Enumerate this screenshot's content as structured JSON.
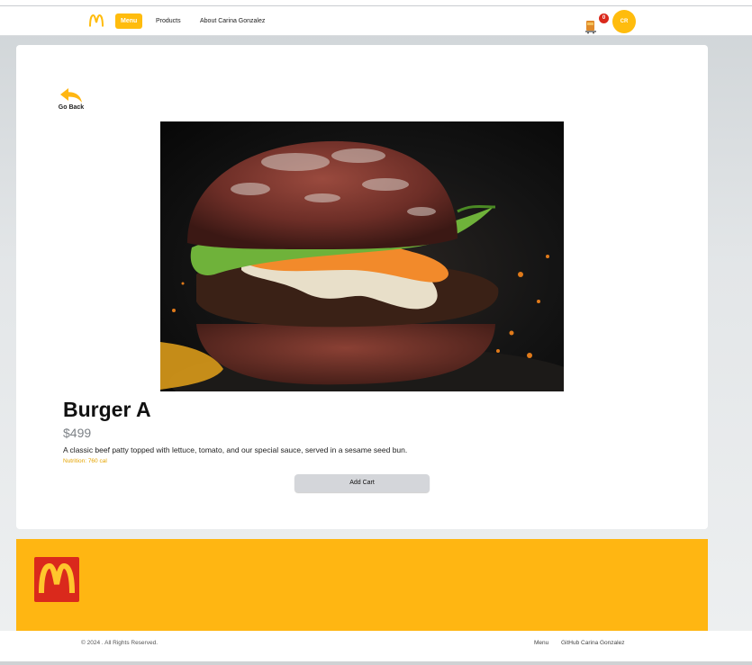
{
  "nav": {
    "links": [
      {
        "label": "Menu",
        "active": true
      },
      {
        "label": "Products",
        "active": false
      },
      {
        "label": "About Carina Gonzalez",
        "active": false
      }
    ],
    "cart_count": "0",
    "avatar_initials": "CR"
  },
  "product": {
    "back_label": "Go Back",
    "title": "Burger A",
    "price": "$499",
    "description": "A classic beef patty topped with lettuce, tomato, and our special sauce, served in a sesame seed bun.",
    "nutrition": "Nutrition: 760 cal",
    "add_button": "Add Cart"
  },
  "footer": {
    "copyright": "© 2024 . All Rights Reserved.",
    "links": [
      "Menu",
      "GitHub Carina Gonzalez"
    ]
  },
  "colors": {
    "brand_yellow": "#ffbc0d",
    "brand_red": "#da291c",
    "footer_yellow": "#ffb612"
  }
}
